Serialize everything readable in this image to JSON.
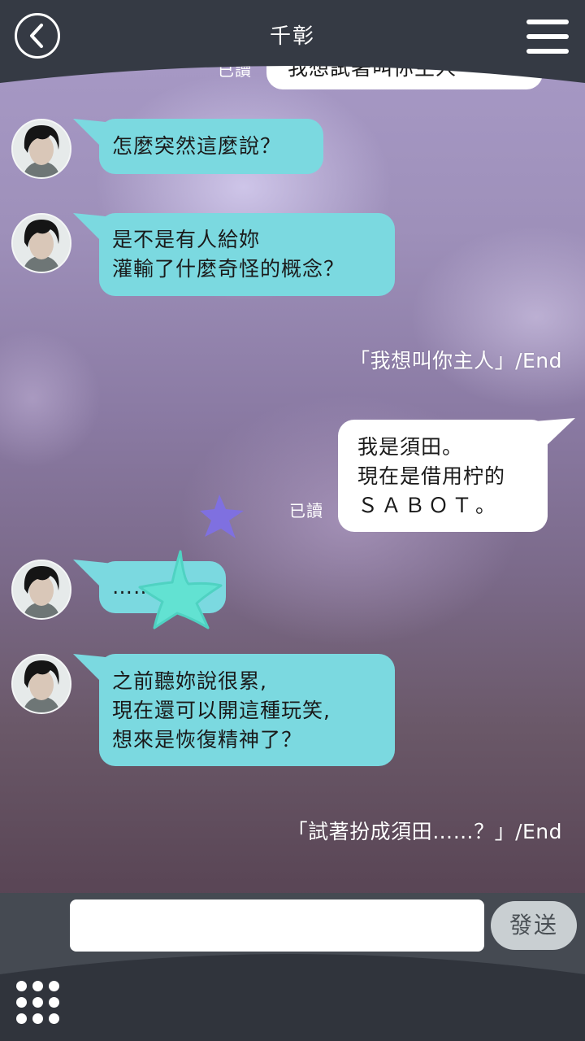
{
  "header": {
    "title": "千彰",
    "back_icon": "chevron-left-icon",
    "menu_icon": "hamburger-menu-icon"
  },
  "top_partial": {
    "read": "已讀",
    "text": "我想試著叫你主人"
  },
  "messages": [
    {
      "lines": [
        "怎麼突然這麼說？"
      ]
    },
    {
      "lines": [
        "是不是有人給妳",
        "灌輸了什麼奇怪的概念？"
      ]
    },
    {
      "lines": [
        "之前聽妳說很累,",
        "現在還可以開這種玩笑,",
        "想來是恢復精神了？"
      ]
    }
  ],
  "choice_1": "「我想叫你主人」/End",
  "sent": {
    "read": "已讀",
    "lines": [
      "我是須田。",
      "現在是借用柠的",
      "ＳＡＢＯＴ。"
    ]
  },
  "ellipsis_message": "……",
  "choice_2": "「試著扮成須田……？」/End",
  "input": {
    "value": "",
    "placeholder": ""
  },
  "send_label": "發送",
  "grid_icon": "grid-dots-icon",
  "colors": {
    "left_bubble": "#7bd9e0",
    "right_bubble": "#ffffff",
    "send_button": "#c9cfd2"
  }
}
